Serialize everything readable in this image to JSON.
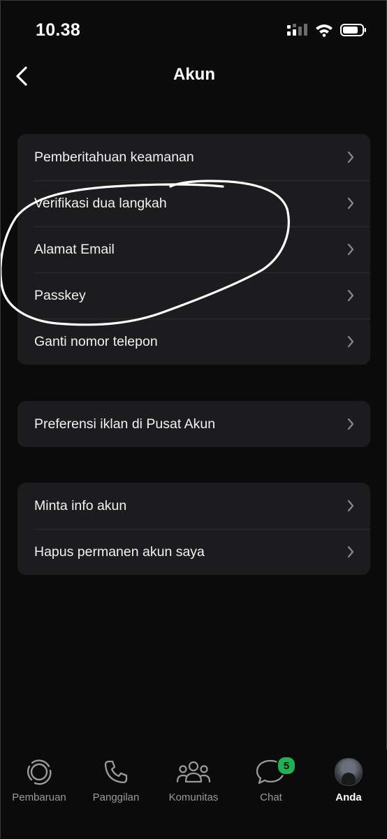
{
  "status_bar": {
    "time": "10.38"
  },
  "header": {
    "title": "Akun"
  },
  "groups": [
    {
      "rows": [
        {
          "label": "Pemberitahuan keamanan"
        },
        {
          "label": "Verifikasi dua langkah"
        },
        {
          "label": "Alamat Email"
        },
        {
          "label": "Passkey"
        },
        {
          "label": "Ganti nomor telepon"
        }
      ]
    },
    {
      "rows": [
        {
          "label": "Preferensi iklan di Pusat Akun"
        }
      ]
    },
    {
      "rows": [
        {
          "label": "Minta info akun"
        },
        {
          "label": "Hapus permanen akun saya"
        }
      ]
    }
  ],
  "tab_bar": {
    "tabs": [
      {
        "label": "Pembaruan",
        "icon": "updates-icon"
      },
      {
        "label": "Panggilan",
        "icon": "phone-icon"
      },
      {
        "label": "Komunitas",
        "icon": "community-icon"
      },
      {
        "label": "Chat",
        "icon": "chat-icon",
        "badge": "5"
      },
      {
        "label": "Anda",
        "icon": "avatar",
        "active": true
      }
    ]
  },
  "colors": {
    "background": "#0b0b0b",
    "card": "#1c1c1e",
    "badge": "#1fb154",
    "inactive_tab": "#9a9a9a"
  }
}
